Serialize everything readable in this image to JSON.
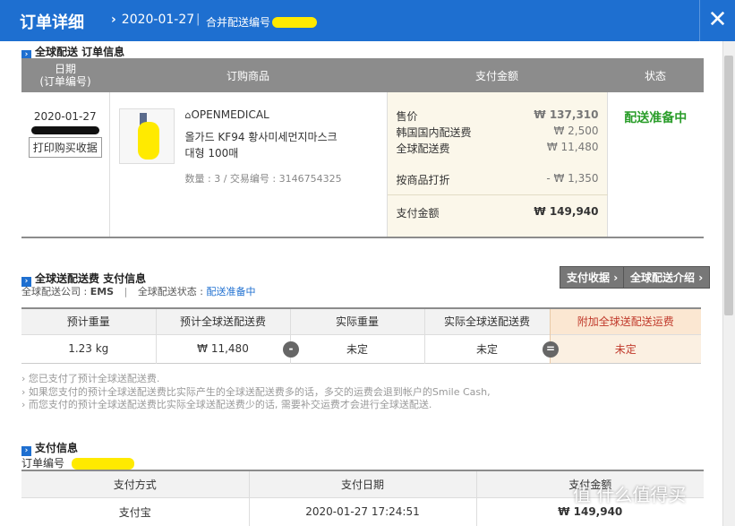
{
  "header": {
    "title": "订单详细",
    "date": "2020-01-27",
    "merge_label": "合并配送编号"
  },
  "order_section": {
    "title": "全球配送 订单信息",
    "columns": {
      "date": "日期",
      "date_sub": "(订单编号)",
      "product": "订购商品",
      "amount": "支付金额",
      "status": "状态"
    },
    "row": {
      "date": "2020-01-27",
      "print_button": "打印购买收据",
      "seller": "OPENMEDICAL",
      "product_name": "올가드 KF94 황사미세먼지마스크 대형 100매",
      "product_meta": "数量 : 3 / 交易编号 : 3146754325",
      "price_label": "售价",
      "price_value": "₩ 137,310",
      "kr_ship_label": "韩国国内配送费",
      "kr_ship_value": "₩ 2,500",
      "global_ship_label": "全球配送费",
      "global_ship_value": "₩ 11,480",
      "discount_label": "按商品打折",
      "discount_value": "- ₩ 1,350",
      "total_label": "支付金额",
      "total_value": "₩ 149,940",
      "status": "配送准备中"
    }
  },
  "shipping_section": {
    "title": "全球送配送费 支付信息",
    "company_label": "全球配送公司 :",
    "company_value": "EMS",
    "status_label": "全球配送状态 :",
    "status_value": "配送准备中",
    "receipt_button": "支付收据",
    "intro_button": "全球配送介绍",
    "columns": [
      "预计重量",
      "预计全球送配送费",
      "实际重量",
      "实际全球送配送费",
      "附加全球送配送运费"
    ],
    "values": [
      "1.23 kg",
      "₩ 11,480",
      "未定",
      "未定",
      "未定"
    ],
    "minus": "-",
    "equals": "=",
    "notes": [
      "您已支付了预计全球送配送费.",
      "如果您支付的预计全球送配送费比实际产生的全球送配送费多的话，多交的运费会退到帐户的Smile Cash,",
      "而您支付的预计全球送配送费比实际全球送配送费少的话, 需要补交运费才会进行全球送配送."
    ]
  },
  "payment_section": {
    "title": "支付信息",
    "order_no_label": "订单编号",
    "columns": [
      "支付方式",
      "支付日期",
      "支付金额"
    ],
    "values": [
      "支付宝",
      "2020-01-27 17:24:51",
      "₩ 149,940"
    ]
  },
  "watermark": "值 什么值得买",
  "colors": {
    "titlebar": "#1e6fd0",
    "status_green": "#2a9d2a",
    "accent_orange": "#c0392b"
  }
}
